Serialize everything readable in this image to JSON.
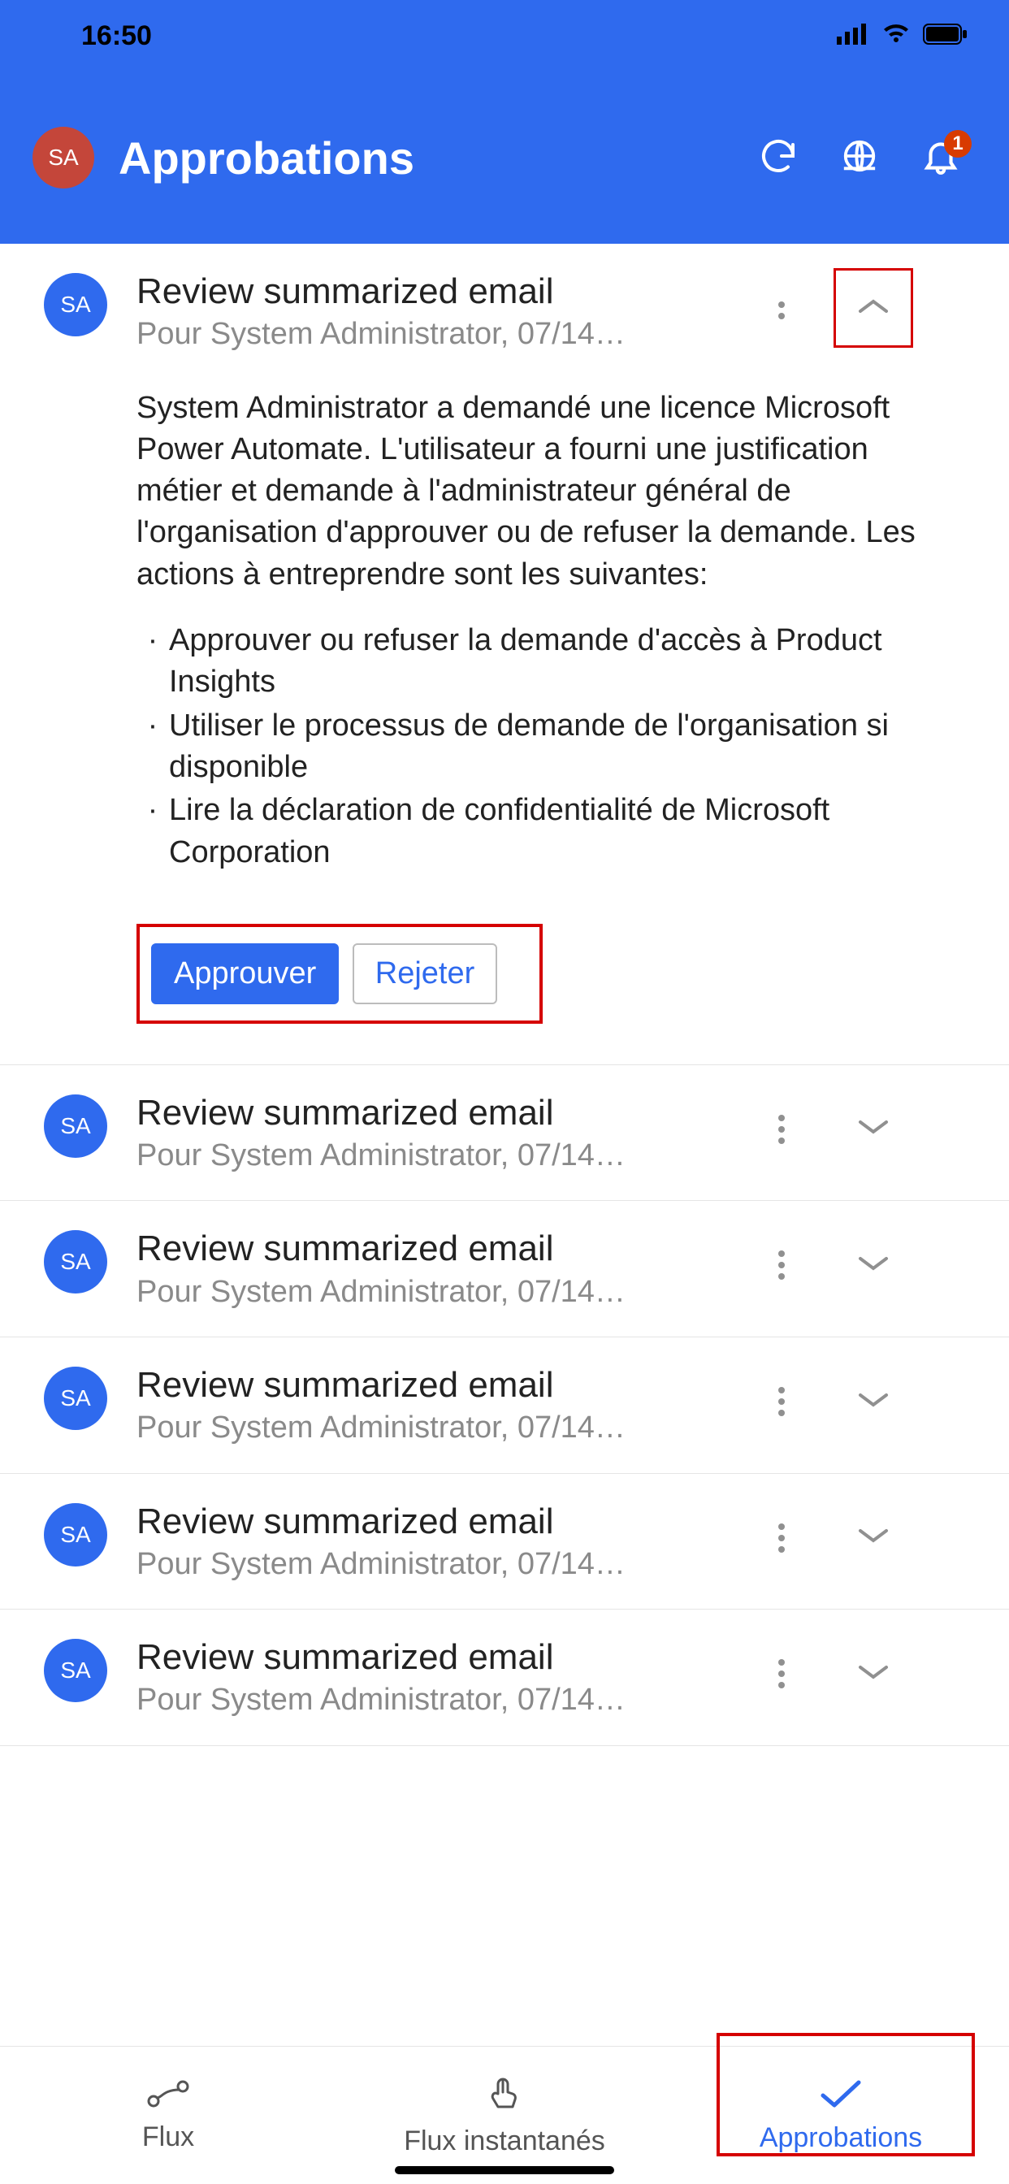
{
  "status": {
    "time": "16:50"
  },
  "header": {
    "avatar": "SA",
    "title": "Approbations",
    "notif_badge": "1"
  },
  "colors": {
    "brand": "#2f6aee",
    "danger_outline": "#d50000",
    "avatar_header": "#c4463a"
  },
  "approvals": [
    {
      "avatar": "SA",
      "title": "Review summarized email",
      "subtitle": "Pour System Administrator, 07/14…",
      "expanded": true,
      "description": "System Administrator a demandé une licence Microsoft Power Automate. L'utilisateur a fourni une justification métier et demande à l'administrateur général de l'organisation d'approuver ou de refuser la demande. Les actions à entreprendre sont les suivantes:",
      "bullets": [
        "Approuver ou refuser la demande d'accès à Product Insights",
        "Utiliser le processus de demande de l'organisation si disponible",
        "Lire la déclaration de confidentialité de Microsoft Corporation"
      ],
      "approve_label": "Approuver",
      "reject_label": "Rejeter"
    },
    {
      "avatar": "SA",
      "title": "Review summarized email",
      "subtitle": "Pour System Administrator, 07/14…",
      "expanded": false
    },
    {
      "avatar": "SA",
      "title": "Review summarized email",
      "subtitle": "Pour System Administrator, 07/14…",
      "expanded": false
    },
    {
      "avatar": "SA",
      "title": "Review summarized email",
      "subtitle": "Pour System Administrator, 07/14…",
      "expanded": false
    },
    {
      "avatar": "SA",
      "title": "Review summarized email",
      "subtitle": "Pour System Administrator, 07/14…",
      "expanded": false
    },
    {
      "avatar": "SA",
      "title": "Review summarized email",
      "subtitle": "Pour System Administrator, 07/14…",
      "expanded": false
    }
  ],
  "tabs": {
    "flows": "Flux",
    "instant": "Flux instantanés",
    "approvals": "Approbations"
  }
}
